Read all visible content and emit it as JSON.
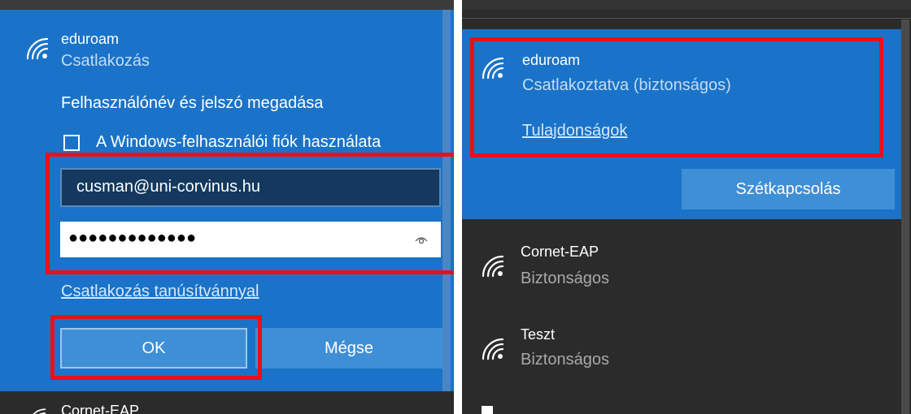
{
  "left": {
    "network_name": "eduroam",
    "network_status": "Csatlakozás",
    "prompt": "Felhasználónév és jelszó megadása",
    "checkbox_label": "A Windows-felhasználói fiók használata",
    "username_value": "cusman@uni-corvinus.hu",
    "password_value": "●●●●●●●●●●●●●",
    "reveal_icon": "eye-icon",
    "cert_link": "Csatlakozás tanúsítvánnyal",
    "ok_label": "OK",
    "cancel_label": "Mégse",
    "next_network": "Cornet-EAP"
  },
  "right": {
    "connected_network": {
      "name": "eduroam",
      "status": "Csatlakoztatva (biztonságos)",
      "properties_link": "Tulajdonságok",
      "disconnect_label": "Szétkapcsolás"
    },
    "networks": [
      {
        "name": "Cornet-EAP",
        "status": "Biztonságos"
      },
      {
        "name": "Teszt",
        "status": "Biztonságos"
      }
    ]
  },
  "colors": {
    "accent_blue": "#1a73c8",
    "dark_bg": "#2b2b2b",
    "highlight_red": "#e8101a"
  }
}
